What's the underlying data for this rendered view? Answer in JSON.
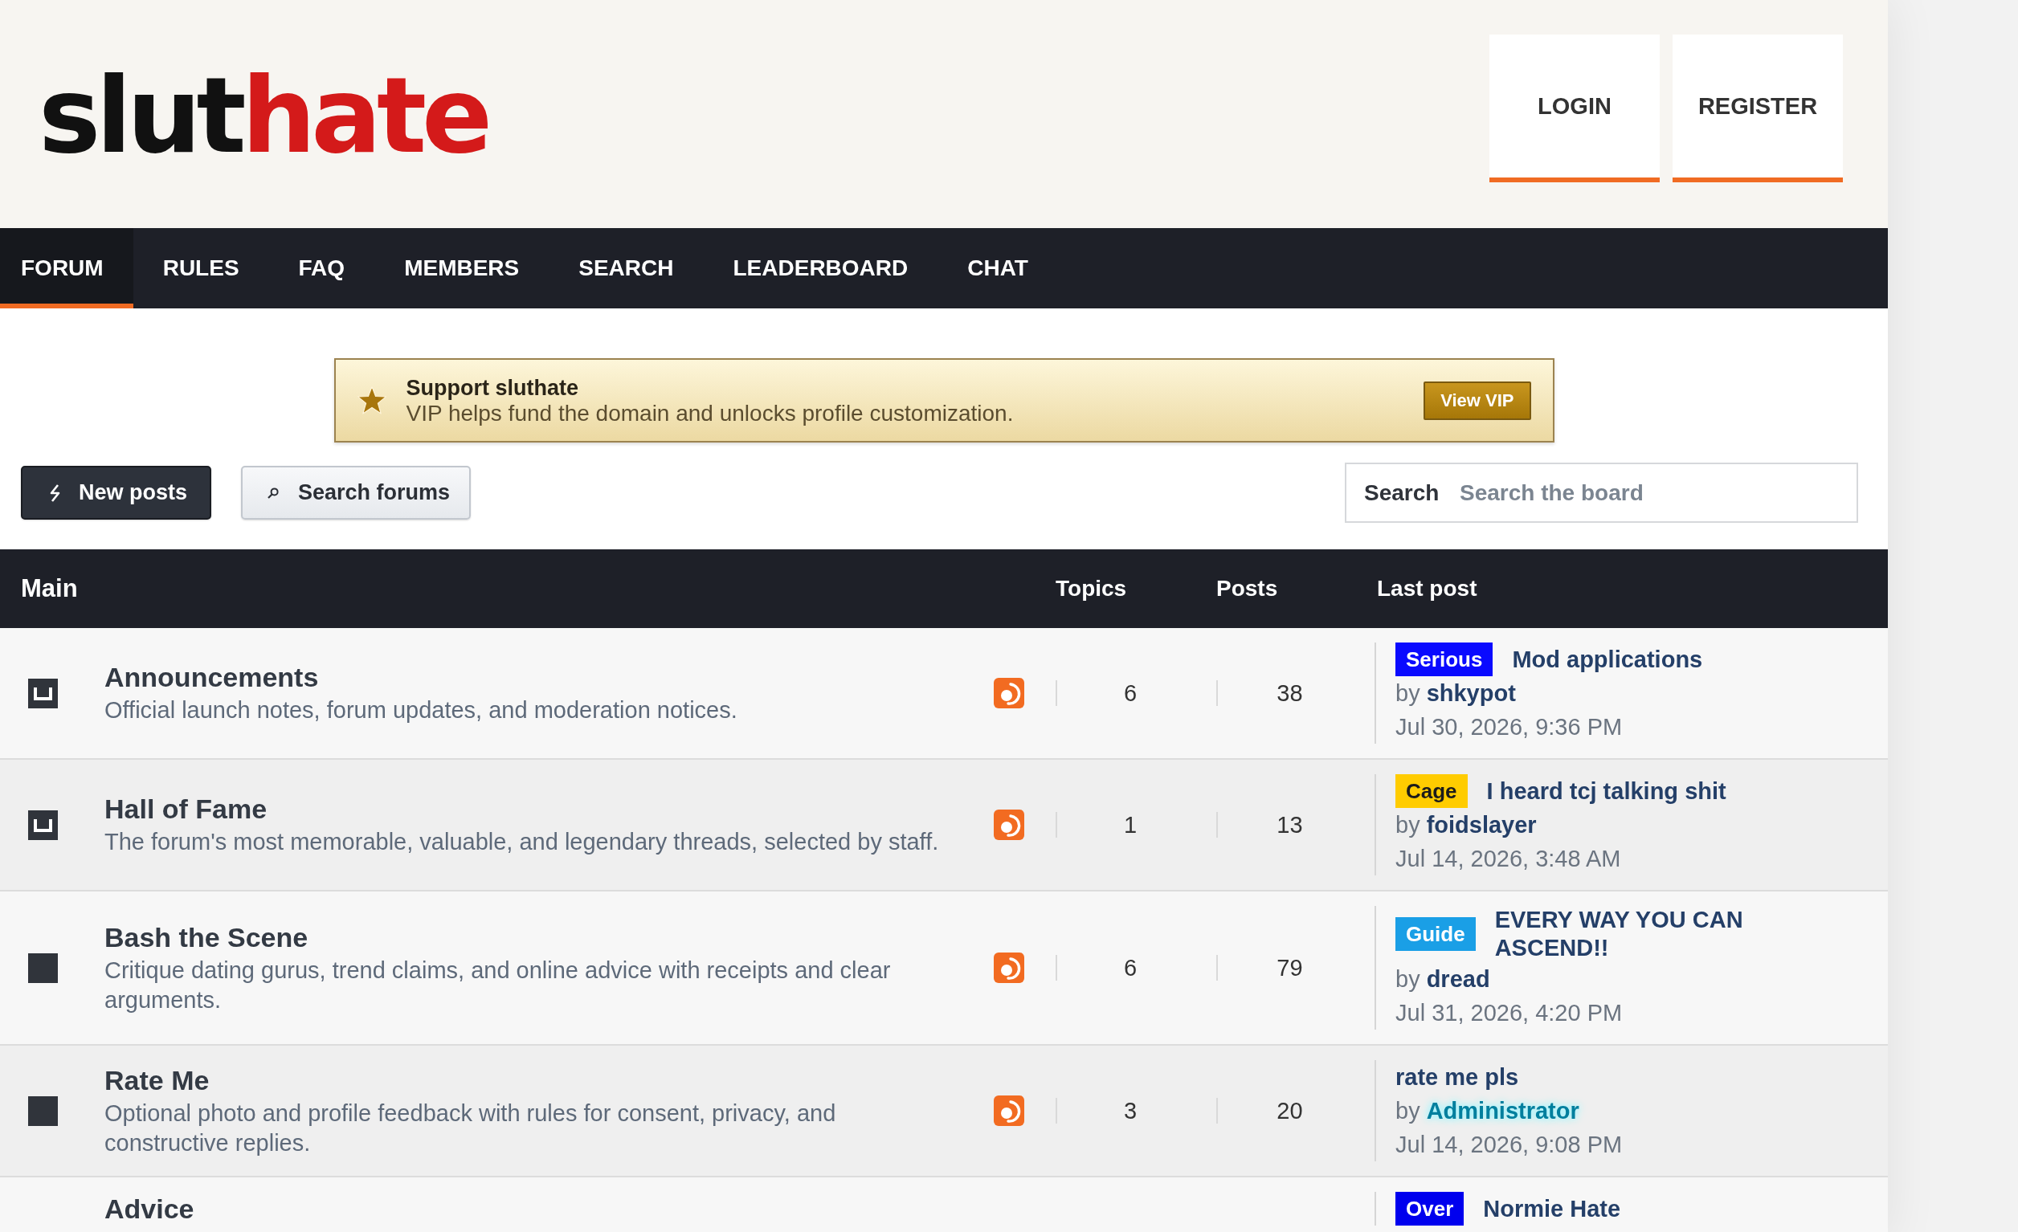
{
  "header": {
    "logo": [
      {
        "text": "slut",
        "color": "#111111"
      },
      {
        "text": "hate",
        "color": "#d41a1a"
      }
    ],
    "buttons": [
      "LOGIN",
      "REGISTER"
    ]
  },
  "nav": [
    {
      "label": "FORUM",
      "selected": true
    },
    {
      "label": "RULES",
      "selected": false
    },
    {
      "label": "FAQ",
      "selected": false
    },
    {
      "label": "MEMBERS",
      "selected": false
    },
    {
      "label": "SEARCH",
      "selected": false
    },
    {
      "label": "LEADERBOARD",
      "selected": false
    },
    {
      "label": "CHAT",
      "selected": false
    }
  ],
  "banner": {
    "title": "Support sluthate",
    "text": "VIP helps fund the domain and unlocks profile customization.",
    "button": "View VIP"
  },
  "actions": [
    {
      "label": "New posts",
      "kind": "primary"
    },
    {
      "label": "Search forums",
      "kind": "secondary"
    }
  ],
  "search": {
    "label": "Search",
    "placeholder": "Search the board"
  },
  "table": {
    "columns": [
      "Main",
      "Topics",
      "Posts",
      "Last post"
    ],
    "forums": [
      {
        "title": "Announcements",
        "description": "Official launch notes, forum updates, and moderation notices.",
        "unread": true,
        "feed": true,
        "topics": "6",
        "posts": "38",
        "last_post": {
          "tag": {
            "label": "Serious",
            "color": "#0a0aff"
          },
          "title": "Mod applications",
          "by": "by",
          "author": {
            "name": "shkypot",
            "kind": "plain"
          },
          "date": "Jul 30, 2026, 9:36 PM"
        }
      },
      {
        "title": "Hall of Fame",
        "description": "The forum's most memorable, valuable, and legendary threads, selected by staff.",
        "unread": true,
        "feed": true,
        "topics": "1",
        "posts": "13",
        "last_post": {
          "tag": {
            "label": "Cage",
            "color": "#ffcc00"
          },
          "title": "I heard tcj talking shit",
          "by": "by",
          "author": {
            "name": "foidslayer",
            "kind": "plain"
          },
          "date": "Jul 14, 2026, 3:48 AM"
        }
      },
      {
        "title": "Bash the Scene",
        "description": "Critique dating gurus, trend claims, and online advice with receipts and clear arguments.",
        "unread": false,
        "feed": true,
        "topics": "6",
        "posts": "79",
        "last_post": {
          "tag": {
            "label": "Guide",
            "color": "#1a9fe6"
          },
          "title": "EVERY WAY YOU CAN ASCEND!!",
          "by": "by",
          "author": {
            "name": "dread",
            "kind": "plain"
          },
          "date": "Jul 31, 2026, 4:20 PM"
        }
      },
      {
        "title": "Rate Me",
        "description": "Optional photo and profile feedback with rules for consent, privacy, and constructive replies.",
        "unread": false,
        "feed": true,
        "topics": "3",
        "posts": "20",
        "last_post": {
          "title": "rate me pls",
          "by": "by",
          "author": {
            "name": "Administrator",
            "kind": "glow"
          },
          "date": "Jul 14, 2026, 9:08 PM"
        }
      },
      {
        "title": "Advice",
        "last_post": {
          "tag": {
            "label": "Over",
            "color": "#0000ee"
          },
          "title": "Normie Hate"
        }
      }
    ]
  }
}
